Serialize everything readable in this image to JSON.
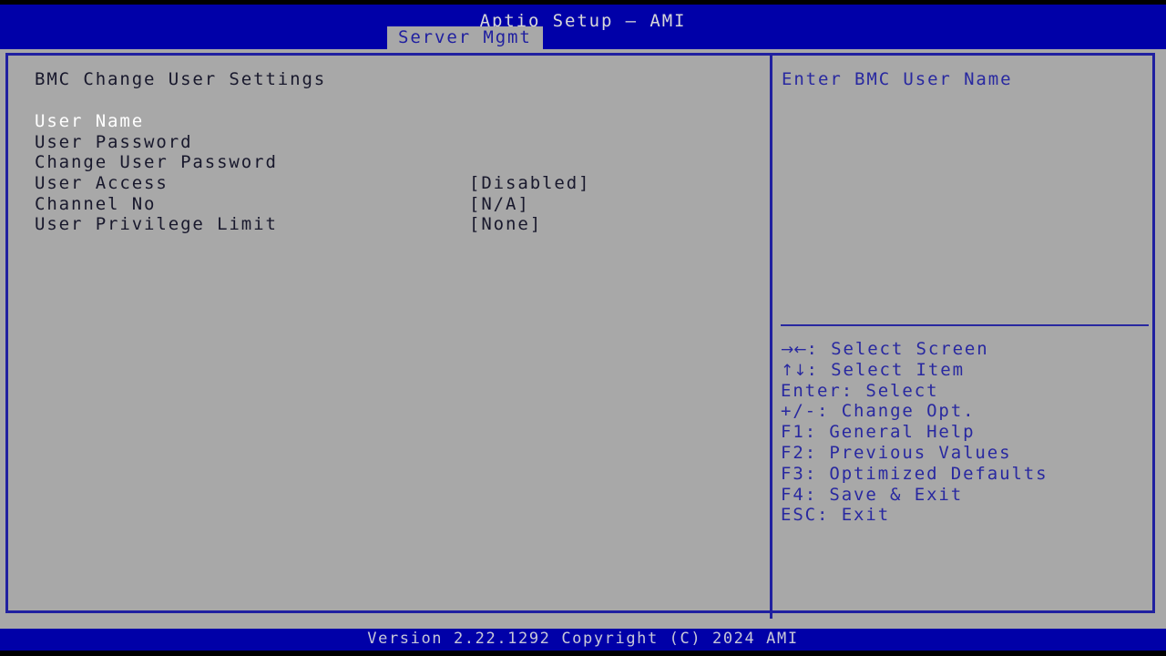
{
  "colors": {
    "header_blue": "#0000a8",
    "panel_gray": "#a8a8a8",
    "border_blue": "#2020a0",
    "help_blue": "#2828a0",
    "label_dark": "#18182c",
    "selected_white": "#ffffff",
    "footer_text": "#c8c8d8"
  },
  "header": {
    "title": "Aptio Setup – AMI",
    "tabs": [
      {
        "label": "Server Mgmt",
        "active": true
      }
    ]
  },
  "main": {
    "heading": "BMC Change User Settings",
    "items": [
      {
        "label": "User Name",
        "value": "",
        "selected": true
      },
      {
        "label": "User Password",
        "value": "",
        "selected": false
      },
      {
        "label": "Change User Password",
        "value": "",
        "selected": false
      },
      {
        "label": "User Access",
        "value": "[Disabled]",
        "selected": false
      },
      {
        "label": "Channel No",
        "value": "[N/A]",
        "selected": false
      },
      {
        "label": "User Privilege Limit",
        "value": "[None]",
        "selected": false
      }
    ]
  },
  "help": {
    "description": "Enter BMC User Name",
    "legend": [
      {
        "key": "→←",
        "glyph": true,
        "text": ": Select Screen"
      },
      {
        "key": "↑↓",
        "glyph": true,
        "text": ": Select Item"
      },
      {
        "key": "Enter",
        "glyph": false,
        "text": ": Select"
      },
      {
        "key": "+/-",
        "glyph": false,
        "text": ": Change Opt."
      },
      {
        "key": "F1",
        "glyph": false,
        "text": ": General Help"
      },
      {
        "key": "F2",
        "glyph": false,
        "text": ": Previous Values"
      },
      {
        "key": "F3",
        "glyph": false,
        "text": ": Optimized Defaults"
      },
      {
        "key": "F4",
        "glyph": false,
        "text": ": Save & Exit"
      },
      {
        "key": "ESC",
        "glyph": false,
        "text": ": Exit"
      }
    ]
  },
  "footer": {
    "version_text": "Version 2.22.1292 Copyright (C) 2024 AMI"
  }
}
